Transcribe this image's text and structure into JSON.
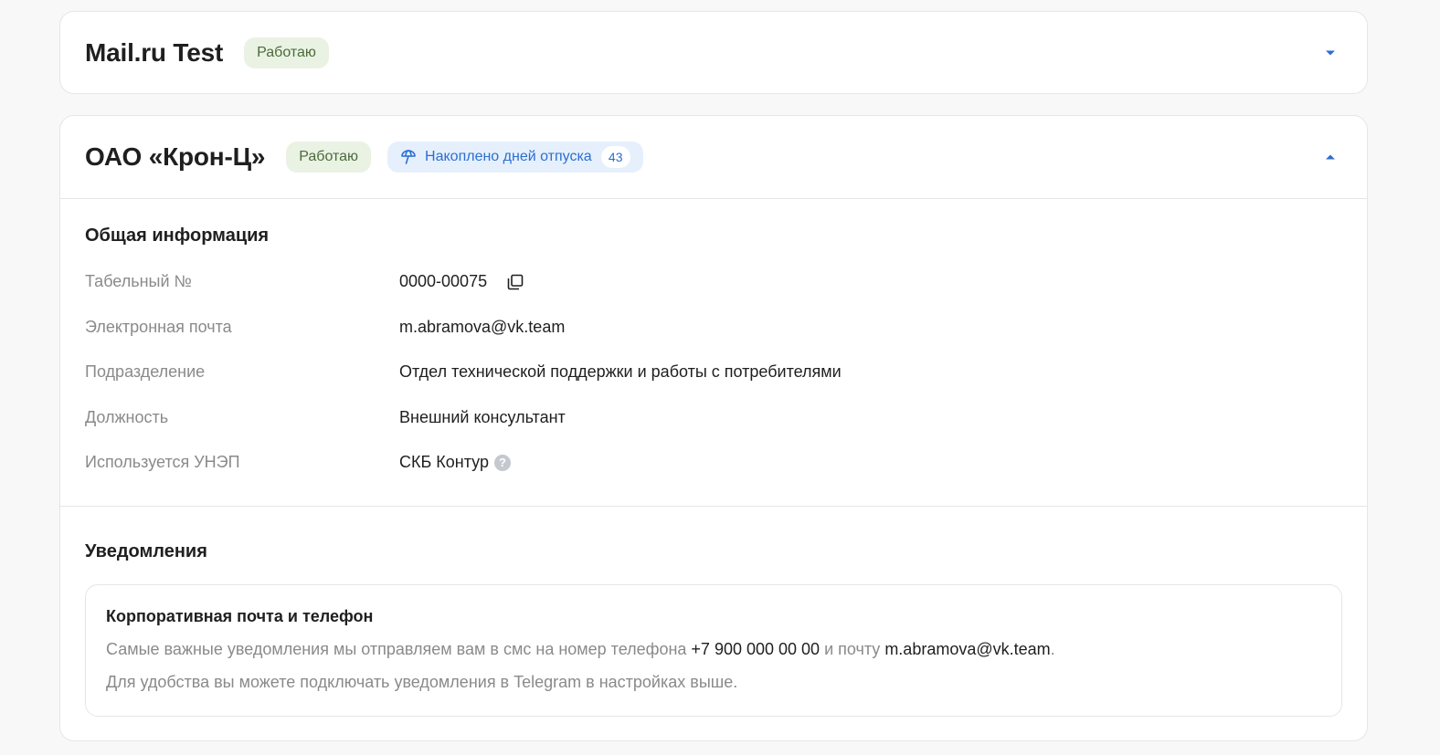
{
  "employers": [
    {
      "name": "Mail.ru Test",
      "status": "Работаю",
      "expanded": false
    },
    {
      "name": "ОАО «Крон-Ц»",
      "status": "Работаю",
      "vacation_label": "Накоплено дней отпуска",
      "vacation_days": "43",
      "expanded": true,
      "general_info": {
        "title": "Общая информация",
        "rows": [
          {
            "label": "Табельный №",
            "value": "0000-00075"
          },
          {
            "label": "Электронная почта",
            "value": "m.abramova@vk.team"
          },
          {
            "label": "Подразделение",
            "value": "Отдел технической поддержки и работы с потребителями"
          },
          {
            "label": "Должность",
            "value": "Внешний консультант"
          },
          {
            "label": "Используется УНЭП",
            "value": "СКБ Контур"
          }
        ]
      },
      "notifications": {
        "title": "Уведомления",
        "box_title": "Корпоративная почта и телефон",
        "text_part1": "Самые важные уведомления мы отправляем вам в смс на номер телефона ",
        "phone": "+7 900 000 00 00",
        "text_part2": " и почту ",
        "email": "m.abramova@vk.team",
        "text_part3": ".",
        "text_line2": "Для удобства вы можете подключать уведомления в Telegram в настройках выше."
      }
    }
  ],
  "colors": {
    "accent": "#2b6fd1",
    "status_bg": "#eaf2e4",
    "status_text": "#4a6b39",
    "vacation_bg": "#e6f0fc",
    "label_gray": "#8a8a8a"
  },
  "icons": {
    "collapsed_chevron": "chevron-down-icon",
    "expanded_chevron": "chevron-up-icon",
    "vacation": "umbrella-icon",
    "copy": "copy-icon",
    "help": "help-icon"
  }
}
